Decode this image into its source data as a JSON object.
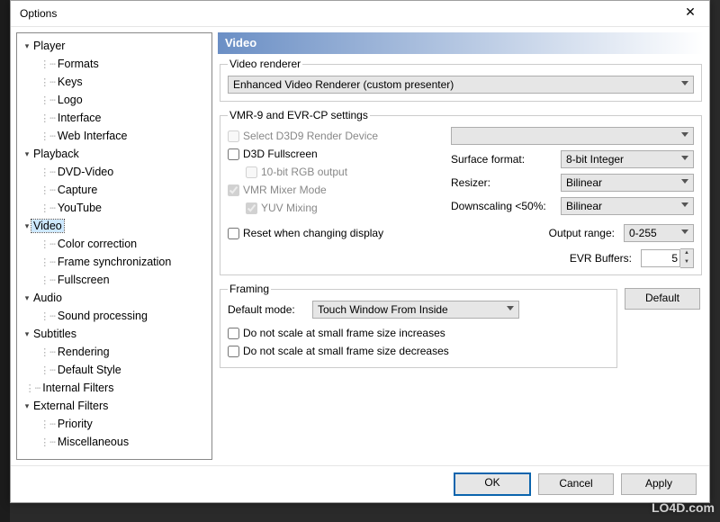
{
  "title": "Options",
  "tree": {
    "player_label": "Player",
    "formats": "Formats",
    "keys": "Keys",
    "logo": "Logo",
    "interface": "Interface",
    "web_interface": "Web Interface",
    "playback_label": "Playback",
    "dvd_video": "DVD-Video",
    "capture": "Capture",
    "youtube": "YouTube",
    "video_label": "Video",
    "color_correction": "Color correction",
    "frame_sync": "Frame synchronization",
    "fullscreen": "Fullscreen",
    "audio_label": "Audio",
    "sound_processing": "Sound processing",
    "subtitles_label": "Subtitles",
    "rendering": "Rendering",
    "default_style": "Default Style",
    "internal_filters": "Internal Filters",
    "external_filters": "External Filters",
    "priority": "Priority",
    "miscellaneous": "Miscellaneous"
  },
  "panel": {
    "heading": "Video",
    "renderer": {
      "legend": "Video renderer",
      "value": "Enhanced Video Renderer (custom presenter)"
    },
    "vmr": {
      "legend": "VMR-9 and EVR-CP settings",
      "select_d3d9": "Select D3D9 Render Device",
      "d3d_fullscreen": "D3D Fullscreen",
      "ten_bit": "10-bit RGB output",
      "vmr_mixer": "VMR Mixer Mode",
      "yuv_mixing": "YUV Mixing",
      "reset_display": "Reset when changing display",
      "surface_format_label": "Surface format:",
      "surface_format_value": "8-bit Integer",
      "resizer_label": "Resizer:",
      "resizer_value": "Bilinear",
      "downscaling_label": "Downscaling <50%:",
      "downscaling_value": "Bilinear",
      "output_range_label": "Output range:",
      "output_range_value": "0-255",
      "evr_buffers_label": "EVR Buffers:",
      "evr_buffers_value": "5"
    },
    "framing": {
      "legend": "Framing",
      "default_mode_label": "Default mode:",
      "default_mode_value": "Touch Window From Inside",
      "no_scale_inc": "Do not scale at small frame size increases",
      "no_scale_dec": "Do not scale at small frame size decreases",
      "default_btn": "Default"
    }
  },
  "buttons": {
    "ok": "OK",
    "cancel": "Cancel",
    "apply": "Apply"
  },
  "watermark": "LO4D.com"
}
